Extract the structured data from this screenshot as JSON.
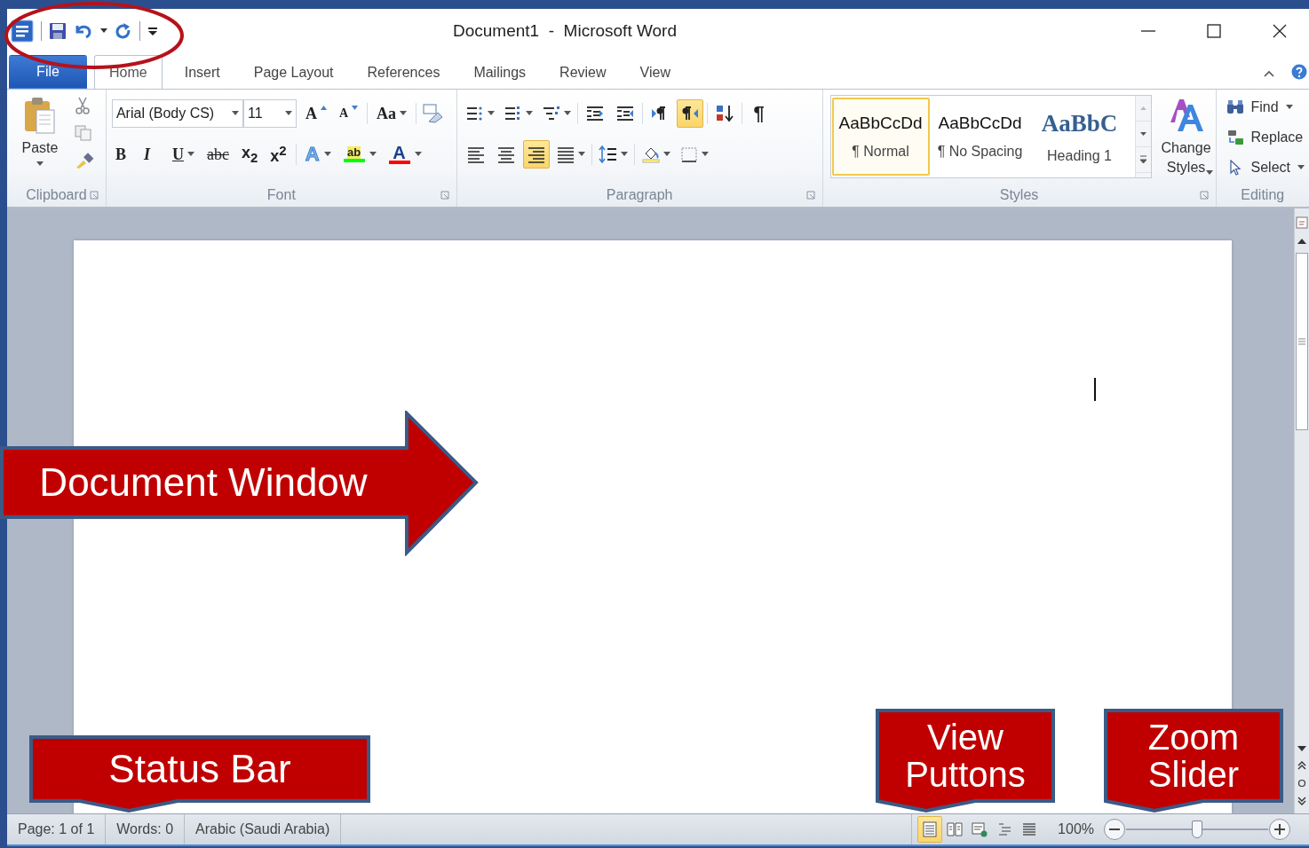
{
  "title_bar": {
    "title": "Document1  -  Microsoft Word"
  },
  "tabs": [
    {
      "label": "File",
      "kind": "file",
      "selected": false
    },
    {
      "label": "Home",
      "kind": "tab",
      "selected": true
    },
    {
      "label": "Insert",
      "kind": "tab",
      "selected": false
    },
    {
      "label": "Page Layout",
      "kind": "tab",
      "selected": false
    },
    {
      "label": "References",
      "kind": "tab",
      "selected": false
    },
    {
      "label": "Mailings",
      "kind": "tab",
      "selected": false
    },
    {
      "label": "Review",
      "kind": "tab",
      "selected": false
    },
    {
      "label": "View",
      "kind": "tab",
      "selected": false
    }
  ],
  "clipboard": {
    "paste": "Paste",
    "group_label": "Clipboard"
  },
  "font": {
    "font_name": "Arial (Body CS)",
    "font_size": "11",
    "row1": [
      {
        "kind": "grow",
        "label": "A"
      },
      {
        "kind": "shrink",
        "label": "A"
      },
      {
        "kind": "case",
        "label": "Aa"
      }
    ],
    "row2": [
      {
        "kind": "bold",
        "label": "B"
      },
      {
        "kind": "italic",
        "label": "I"
      },
      {
        "kind": "underline",
        "label": "U"
      },
      {
        "kind": "strike",
        "label": "abc"
      },
      {
        "kind": "subscript",
        "label": "x$_{2}$"
      },
      {
        "kind": "superscript",
        "label": "x$^{2}$"
      }
    ],
    "effects": [
      {
        "kind": "text_effects",
        "label": "A",
        "color": "#7fb2ea"
      },
      {
        "kind": "highlight",
        "label": "ab",
        "color": "#00ff00"
      },
      {
        "kind": "font_color",
        "label": "A",
        "color": "#ff0000"
      }
    ],
    "group_label": "Font"
  },
  "paragraph": {
    "row1": [
      {
        "kind": "bullets",
        "selected": false
      },
      {
        "kind": "numbering",
        "selected": false
      },
      {
        "kind": "multilevel",
        "selected": false
      },
      {
        "kind": "decrease_indent",
        "selected": false
      },
      {
        "kind": "increase_indent",
        "selected": false
      },
      {
        "kind": "ltr",
        "selected": false
      },
      {
        "kind": "rtl",
        "selected": true
      },
      {
        "kind": "sort",
        "selected": false
      },
      {
        "kind": "show_marks",
        "label": "¶",
        "selected": false
      }
    ],
    "row2": [
      {
        "kind": "align_left",
        "selected": false
      },
      {
        "kind": "align_center",
        "selected": false
      },
      {
        "kind": "align_right",
        "selected": true
      },
      {
        "kind": "justify",
        "selected": false
      },
      {
        "kind": "line_spacing",
        "selected": false
      },
      {
        "kind": "shading",
        "selected": false
      },
      {
        "kind": "borders",
        "selected": false
      }
    ],
    "group_label": "Paragraph"
  },
  "styles": {
    "gallery": [
      {
        "kind": "body",
        "preview": "AaBbCcDd",
        "name": "¶ Normal",
        "selected": true
      },
      {
        "kind": "body",
        "preview": "AaBbCcDd",
        "name": "¶ No Spacing",
        "selected": false
      },
      {
        "kind": "heading",
        "preview": "AaBbC",
        "name": "Heading 1",
        "selected": false
      }
    ],
    "change_styles": "Change Styles",
    "group_label": "Styles"
  },
  "editing": {
    "items": [
      {
        "kind": "find",
        "label": "Find"
      },
      {
        "kind": "replace",
        "label": "Replace"
      },
      {
        "kind": "select",
        "label": "Select"
      }
    ],
    "group_label": "Editing"
  },
  "status_bar": {
    "items": [
      "Page: 1 of 1",
      "Words: 0",
      "Arabic (Saudi Arabia)"
    ],
    "views": [
      {
        "kind": "print_layout",
        "selected": true
      },
      {
        "kind": "reading",
        "selected": false
      },
      {
        "kind": "web_layout",
        "selected": false
      },
      {
        "kind": "outline",
        "selected": false
      },
      {
        "kind": "draft",
        "selected": false
      }
    ],
    "zoom": "100%",
    "zoom_slider": {
      "level": 0.5
    }
  },
  "callouts": [
    {
      "kind": "arrow",
      "text": "Document Window"
    },
    {
      "kind": "box",
      "text": "Status Bar"
    },
    {
      "kind": "box",
      "text": "View Puttons"
    },
    {
      "kind": "box",
      "text": "Zoom Slider"
    }
  ]
}
